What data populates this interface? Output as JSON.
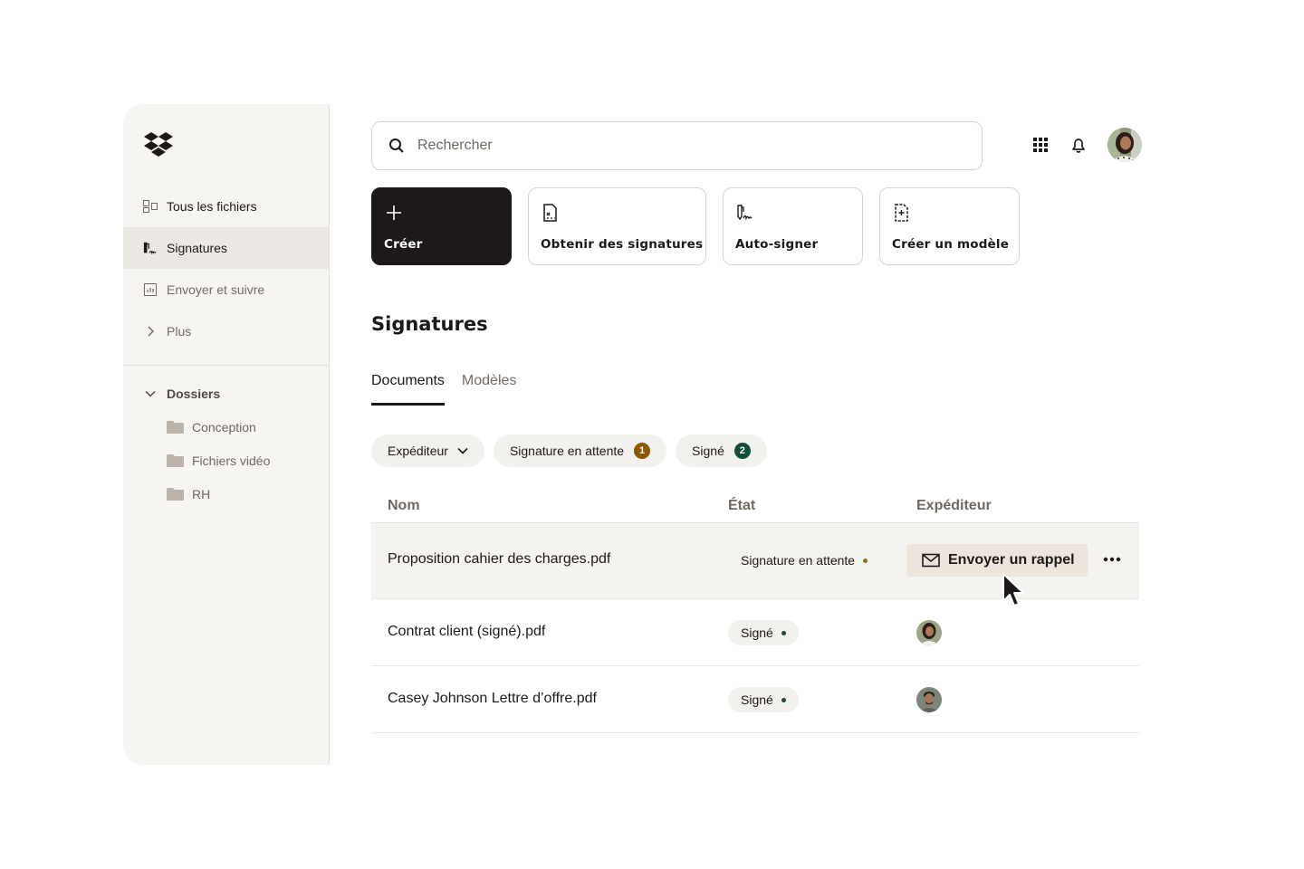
{
  "sidebar": {
    "logo": "dropbox-logo",
    "nav": [
      {
        "label": "Tous les fichiers",
        "icon": "files-icon",
        "active": false
      },
      {
        "label": "Signatures",
        "icon": "signature-icon",
        "active": true
      },
      {
        "label": "Envoyer et suivre",
        "icon": "chart-icon",
        "active": false
      },
      {
        "label": "Plus",
        "icon": "chevron-right-icon",
        "active": false
      }
    ],
    "folders": {
      "header": "Dossiers",
      "items": [
        {
          "label": "Conception"
        },
        {
          "label": "Fichiers vidéo"
        },
        {
          "label": "RH"
        }
      ]
    }
  },
  "header": {
    "search": {
      "placeholder": "Rechercher",
      "value": ""
    },
    "icons": [
      "apps-grid-icon",
      "bell-icon",
      "user-avatar"
    ]
  },
  "actions": [
    {
      "label": "Créer",
      "icon": "plus-icon"
    },
    {
      "label": "Obtenir des signatures",
      "icon": "document-sign-icon"
    },
    {
      "label": "Auto-signer",
      "icon": "pen-signature-icon"
    },
    {
      "label": "Créer un modèle",
      "icon": "template-add-icon"
    }
  ],
  "page": {
    "title": "Signatures",
    "tabs": [
      {
        "label": "Documents",
        "active": true
      },
      {
        "label": "Modèles",
        "active": false
      }
    ],
    "filters": [
      {
        "label": "Expéditeur",
        "type": "dropdown"
      },
      {
        "label": "Signature en attente",
        "count": "1",
        "color": "#8a5a00"
      },
      {
        "label": "Signé",
        "count": "2",
        "color": "#0f503c"
      }
    ]
  },
  "table": {
    "columns": [
      "Nom",
      "État",
      "Expéditeur"
    ],
    "rows": [
      {
        "name": "Proposition cahier des charges.pdf",
        "status": "Signature en attente",
        "status_color": "#9b6a1c",
        "action": "Envoyer un rappel",
        "more": "•••"
      },
      {
        "name": "Contrat client (signé).pdf",
        "status": "Signé",
        "status_color": "#0f503c",
        "sender": "woman-avatar"
      },
      {
        "name": "Casey Johnson Lettre d’offre.pdf",
        "status": "Signé",
        "status_color": "#0f503c",
        "sender": "man-avatar"
      }
    ]
  }
}
